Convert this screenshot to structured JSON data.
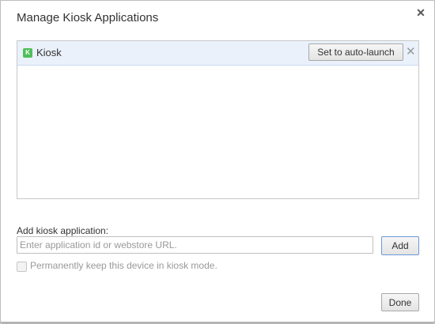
{
  "dialog": {
    "title": "Manage Kiosk Applications",
    "close_icon": "close-icon"
  },
  "apps": [
    {
      "icon": "kiosk-app-icon",
      "icon_letter": "K",
      "name": "Kiosk",
      "auto_launch_label": "Set to auto-launch",
      "remove_icon": "remove-icon"
    }
  ],
  "add_section": {
    "label": "Add kiosk application:",
    "input_value": "",
    "input_placeholder": "Enter application id or webstore URL.",
    "add_label": "Add"
  },
  "keep_kiosk": {
    "checked": false,
    "label": "Permanently keep this device in kiosk mode."
  },
  "footer": {
    "done_label": "Done"
  },
  "colors": {
    "app_icon": "#4fbf5a",
    "selected_row": "#eaf1fb",
    "focus_border": "#6a9ad8"
  }
}
